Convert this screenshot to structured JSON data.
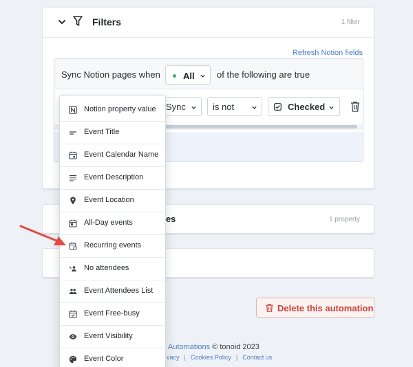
{
  "filters": {
    "title": "Filters",
    "count": "1 filter",
    "refresh_link": "Refresh Notion fields",
    "sync_label": "Sync Notion pages when",
    "match_value": "All",
    "following_label": "of the following are true",
    "condition": {
      "property": "Sync",
      "operator": "is not",
      "value": "Checked"
    }
  },
  "properties_card": {
    "title_fragment": "ues",
    "count": "1 property"
  },
  "delete_button": {
    "label": "Delete this automation"
  },
  "footer": {
    "brand": "Automations",
    "copyright": " © tonoid 2023",
    "link_privacy": "vacy",
    "separator": "|",
    "link_cookies": "Cookies Policy",
    "link_contact": "Contact us"
  },
  "dropdown": {
    "items": [
      {
        "label": "Notion property value",
        "icon": "notion-icon"
      },
      {
        "label": "Event Title",
        "icon": "short-text-icon"
      },
      {
        "label": "Event Calendar Name",
        "icon": "calendar-icon"
      },
      {
        "label": "Event Description",
        "icon": "long-text-icon"
      },
      {
        "label": "Event Location",
        "icon": "location-pin-icon"
      },
      {
        "label": "All-Day events",
        "icon": "calendar-day-icon"
      },
      {
        "label": "Recurring events",
        "icon": "calendar-repeat-icon"
      },
      {
        "label": "No attendees",
        "icon": "people-off-icon"
      },
      {
        "label": "Event Attendees List",
        "icon": "people-icon"
      },
      {
        "label": "Event Free-busy",
        "icon": "calendar-busy-icon"
      },
      {
        "label": "Event Visibility",
        "icon": "eye-icon"
      },
      {
        "label": "Event Color",
        "icon": "palette-icon"
      }
    ]
  },
  "colors": {
    "accent_link": "#4a7fc1",
    "danger": "#c6433a",
    "status_green": "#3fb26b",
    "arrow_red": "#e24a42"
  }
}
